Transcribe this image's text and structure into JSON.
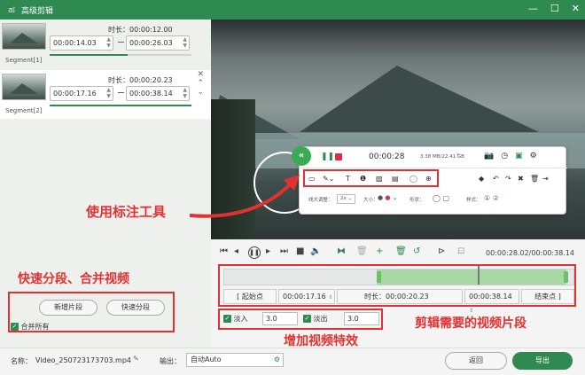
{
  "window": {
    "title": "高级剪辑",
    "colors": {
      "titlebar": "#2f8a52",
      "accent": "#2f8a52",
      "annotation": "#e33131"
    }
  },
  "segments": [
    {
      "label": "Segment[1]",
      "duration_label": "时长：00:00:12.00",
      "start": "00:00:14.03",
      "end": "00:00:26.03",
      "progress": 0.55
    },
    {
      "label": "Segment[2]",
      "duration_label": "时长：00:00:20.23",
      "start": "00:00:17.16",
      "end": "00:00:38.14",
      "progress": 1.0
    }
  ],
  "annot_toolbar": {
    "time": "00:00:28",
    "size": "3.38 MB/22.41 GB",
    "row3": {
      "line_width_label": "线大调整：",
      "line_width_value": "2x",
      "size_label": "大小：",
      "shape_label": "形状：",
      "style_label": "样式："
    }
  },
  "player": {
    "current_total": "00:00:28.02/00:00:38.14"
  },
  "trim": {
    "start_button": "起始点",
    "start_value": "00:00:17.16",
    "duration": "时长：00:00:20.23",
    "end_value": "00:00:38.14",
    "end_button": "结束点"
  },
  "effects": {
    "fade_in_label": "淡入",
    "fade_in_value": "3.0",
    "fade_out_label": "淡出",
    "fade_out_value": "3.0"
  },
  "left_buttons": {
    "add_segment": "新增片段",
    "quick_split": "快速分段",
    "merge_all": "合并所有"
  },
  "bottom": {
    "name_label": "名称：",
    "file_name": "Video_250723173703.mp4",
    "output_label": "输出：",
    "output_value": "自动Auto",
    "back_button": "返回",
    "export_button": "导出"
  },
  "annotations": {
    "use_annotation": "使用标注工具",
    "quick_split_merge": "快速分段、合并视频",
    "trim_segment": "剪辑需要的视频片段",
    "add_effects": "增加视频特效"
  }
}
